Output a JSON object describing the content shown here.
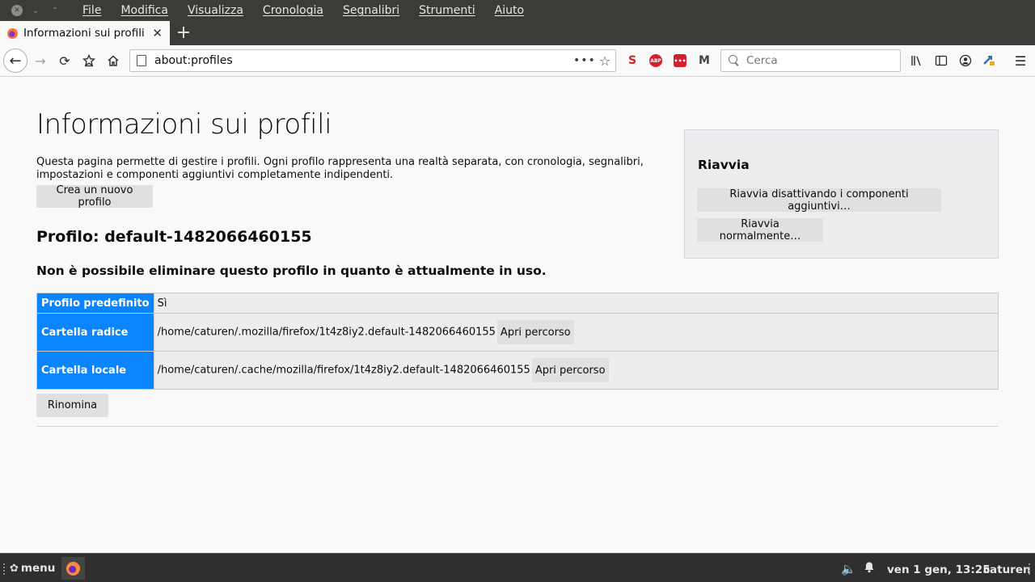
{
  "menubar": {
    "items": [
      "File",
      "Modifica",
      "Visualizza",
      "Cronologia",
      "Segnalibri",
      "Strumenti",
      "Aiuto"
    ]
  },
  "tab": {
    "title": "Informazioni sui profili",
    "close_glyph": "✕",
    "new_tab_glyph": "+"
  },
  "navbar": {
    "back_glyph": "←",
    "forward_glyph": "→",
    "reload_glyph": "⟳",
    "url": "about:profiles",
    "page_actions_glyph": "•••",
    "bookmark_glyph": "☆",
    "search_placeholder": "Cerca",
    "extensions": {
      "s": "S",
      "abp": "ABP",
      "lastpass": "•••",
      "gmail": "M"
    }
  },
  "page": {
    "title": "Informazioni sui profili",
    "description": "Questa pagina permette di gestire i profili. Ogni profilo rappresenta una realtà separata, con cronologia, segnalibri, impostazioni e componenti aggiuntivi completamente indipendenti.",
    "create_button": "Crea un nuovo profilo",
    "profile_heading": "Profilo: default-1482066460155",
    "in_use_message": "Non è possibile eliminare questo profilo in quanto è attualmente in uso.",
    "table": {
      "default_label": "Profilo predefinito",
      "default_value": "Sì",
      "root_label": "Cartella radice",
      "root_path": "/home/caturen/.mozilla/firefox/1t4z8iy2.default-1482066460155",
      "local_label": "Cartella locale",
      "local_path": "/home/caturen/.cache/mozilla/firefox/1t4z8iy2.default-1482066460155",
      "open_button": "Apri percorso"
    },
    "rename_button": "Rinomina",
    "restart": {
      "title": "Riavvia",
      "addons_button": "Riavvia disattivando i componenti aggiuntivi…",
      "normal_button": "Riavvia normalmente…"
    }
  },
  "taskbar": {
    "menu_label": "menu",
    "clock": "ven  1 gen, 13:25",
    "user": "caturen"
  },
  "colors": {
    "accent": "#0a84ff",
    "titlebar": "#3c3b37",
    "taskbar": "#2f2f2f"
  }
}
